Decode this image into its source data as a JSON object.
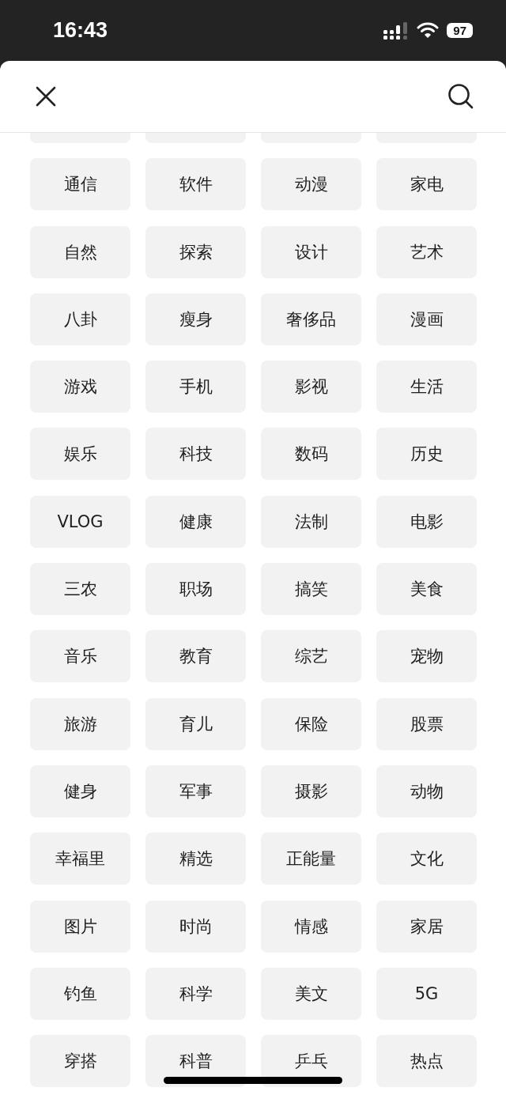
{
  "status_bar": {
    "time": "16:43",
    "battery": "97"
  },
  "categories": [
    [
      "通信",
      "软件",
      "动漫",
      "家电"
    ],
    [
      "自然",
      "探索",
      "设计",
      "艺术"
    ],
    [
      "八卦",
      "瘦身",
      "奢侈品",
      "漫画"
    ],
    [
      "游戏",
      "手机",
      "影视",
      "生活"
    ],
    [
      "娱乐",
      "科技",
      "数码",
      "历史"
    ],
    [
      "VLOG",
      "健康",
      "法制",
      "电影"
    ],
    [
      "三农",
      "职场",
      "搞笑",
      "美食"
    ],
    [
      "音乐",
      "教育",
      "综艺",
      "宠物"
    ],
    [
      "旅游",
      "育儿",
      "保险",
      "股票"
    ],
    [
      "健身",
      "军事",
      "摄影",
      "动物"
    ],
    [
      "幸福里",
      "精选",
      "正能量",
      "文化"
    ],
    [
      "图片",
      "时尚",
      "情感",
      "家居"
    ],
    [
      "钓鱼",
      "科学",
      "美文",
      "5G"
    ],
    [
      "穿搭",
      "科普",
      "乒乓",
      "热点"
    ]
  ]
}
